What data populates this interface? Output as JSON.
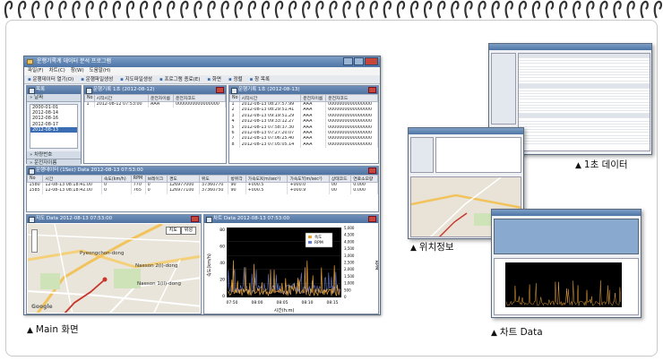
{
  "main_window": {
    "title": "운행기록계 데이터 분석 프로그램",
    "menu": [
      "파일(F)",
      "차트(C)",
      "창(W)",
      "도움말(H)"
    ],
    "toolbar": [
      "운행데이터 열기(O)",
      "운행파일생성",
      "지도파일생성",
      "프로그램 종료(E)",
      "화면",
      "정렬",
      "창 목록"
    ],
    "sidebar": {
      "header": "목록",
      "date_section": "날짜",
      "dates": [
        "2000-01-01",
        "2012-08-14",
        "2012-08-16",
        "2012-08-17",
        "2012-08-13"
      ],
      "selected_index": 4,
      "sections": [
        "차량번호",
        "운전자이름"
      ]
    },
    "record_pane_1": {
      "title": "운행기록 1초 (2012-08-12)",
      "columns": [
        "No",
        "시작시간",
        "운전자이름",
        "운전자코드"
      ],
      "rows": [
        [
          "1",
          "2012-08-12 07:53:00",
          "AAA",
          "0000000000000000"
        ]
      ]
    },
    "record_pane_2": {
      "title": "운행기록 1초 (2012-08-13)",
      "columns": [
        "No",
        "시작시간",
        "운전자이름",
        "운전자코드"
      ],
      "rows": [
        [
          "1",
          "2012-08-13 08:27:57.99",
          "AAA",
          "0000000000000000"
        ],
        [
          "2",
          "2012-08-13 08:29:51.41",
          "AAA",
          "0000000000000000"
        ],
        [
          "3",
          "2012-08-13 09:19:51.29",
          "AAA",
          "0000000000000000"
        ],
        [
          "4",
          "2012-08-13 09:33:12.27",
          "AAA",
          "0000000000000000"
        ],
        [
          "5",
          "2012-08-13 07:58:37.30",
          "AAA",
          "0000000000000000"
        ],
        [
          "6",
          "2012-08-13 07:27:20.07",
          "AAA",
          "0000000000000000"
        ],
        [
          "7",
          "2012-08-13 07:06:25.40",
          "AAA",
          "0000000000000000"
        ],
        [
          "8",
          "2012-08-13 07:05:05.14",
          "AAA",
          "0000000000000000"
        ]
      ]
    },
    "data_pane": {
      "title": "운행데이터 (1Sec) Data 2012-08-13 07:53:00",
      "columns": [
        "No",
        "시간",
        "속도(km/h)",
        "RPM",
        "브레이크",
        "경도",
        "위도",
        "방위각",
        "가속도X(m/sec²)",
        "가속도Y(m/sec²)",
        "상태코드",
        "연료소모량"
      ],
      "rows": [
        [
          "1580",
          "12-08-13 08:18:41.00",
          "0",
          "770",
          "0",
          "126977000",
          "37360770",
          "90",
          "+000.5",
          "+000.0",
          "00",
          "0.000"
        ],
        [
          "1585",
          "12-08-13 08:18:42.00",
          "0",
          "765",
          "0",
          "126977100",
          "37360750",
          "90",
          "+000.5",
          "+000.9",
          "00",
          "0.000"
        ]
      ]
    },
    "map_pane": {
      "title": "지도 Data 2012-08-13 07:53:00",
      "map_type": "지도",
      "satellite": "위성",
      "labels": [
        "Pyeongchon-dong",
        "Naeson 2(i)-dong",
        "Naeson 1(il)-dong",
        "Google"
      ]
    },
    "chart_pane": {
      "title": "차트 Data 2012-08-13 07:53:00",
      "legend": [
        "속도",
        "RPM"
      ],
      "y_left_label": "속도(km/h)",
      "y_right_label": "RPM",
      "x_label": "시간(h:m)",
      "x_ticks": [
        "07:50",
        "08:00",
        "08:05",
        "08:10",
        "08:15"
      ],
      "y_left_ticks": [
        "80",
        "60",
        "40",
        "20",
        "0"
      ],
      "y_right_ticks": [
        "5,000",
        "4,500",
        "4,000",
        "3,500",
        "3,000",
        "2,500",
        "2,000",
        "1,500",
        "1,000",
        "500",
        "0"
      ]
    }
  },
  "captions": {
    "main": "Main 화면",
    "location": "위치정보",
    "one_sec": "1초 데이터",
    "chart": "차트 Data"
  },
  "colors": {
    "title_bar": "#4d74a6",
    "speed_series": "#e8a33a",
    "rpm_series": "#6b7cc8"
  }
}
